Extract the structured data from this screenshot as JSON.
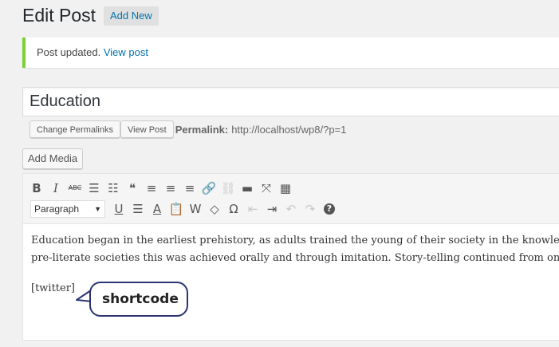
{
  "header": {
    "title": "Edit Post",
    "add_new": "Add New"
  },
  "notice": {
    "text": "Post updated.",
    "link": "View post",
    "color": "#7ad03a"
  },
  "post": {
    "title": "Education"
  },
  "permalink": {
    "change_button": "Change Permalinks",
    "view_button": "View Post",
    "label": "Permalink:",
    "url": "http://localhost/wp8/?p=1"
  },
  "media": {
    "add_media": "Add Media"
  },
  "toolbar": {
    "row1": [
      {
        "name": "bold-icon",
        "glyph": "B"
      },
      {
        "name": "italic-icon",
        "glyph": "I"
      },
      {
        "name": "strikethrough-icon",
        "glyph": "ABC"
      },
      {
        "name": "bullet-list-icon",
        "glyph": "☰"
      },
      {
        "name": "numbered-list-icon",
        "glyph": "☷"
      },
      {
        "name": "blockquote-icon",
        "glyph": "❝"
      },
      {
        "name": "align-left-icon",
        "glyph": "≡"
      },
      {
        "name": "align-center-icon",
        "glyph": "≡"
      },
      {
        "name": "align-right-icon",
        "glyph": "≡"
      },
      {
        "name": "insert-link-icon",
        "glyph": "🔗"
      },
      {
        "name": "unlink-icon",
        "glyph": "⛓"
      },
      {
        "name": "read-more-icon",
        "glyph": "▬"
      },
      {
        "name": "fullscreen-icon",
        "glyph": "⤧"
      },
      {
        "name": "toolbar-toggle-icon",
        "glyph": "▦"
      }
    ],
    "format_select": "Paragraph",
    "row2": [
      {
        "name": "underline-icon",
        "glyph": "U"
      },
      {
        "name": "justify-icon",
        "glyph": "☰"
      },
      {
        "name": "text-color-icon",
        "glyph": "A"
      },
      {
        "name": "paste-as-text-icon",
        "glyph": "📋"
      },
      {
        "name": "paste-from-word-icon",
        "glyph": "W"
      },
      {
        "name": "clear-formatting-icon",
        "glyph": "◇"
      },
      {
        "name": "special-character-icon",
        "glyph": "Ω"
      },
      {
        "name": "outdent-icon",
        "glyph": "⇤"
      },
      {
        "name": "indent-icon",
        "glyph": "⇥"
      },
      {
        "name": "undo-icon",
        "glyph": "↶"
      },
      {
        "name": "redo-icon",
        "glyph": "↷"
      },
      {
        "name": "help-icon",
        "glyph": "?"
      }
    ]
  },
  "content": {
    "line1": "Education began in the earliest prehistory, as adults trained the young of their society in the knowledge and s",
    "line2": "pre-literate societies this was achieved orally and through imitation. Story-telling continued from one genera",
    "shortcode": "[twitter]"
  },
  "callout": {
    "text": "shortcode",
    "border_color": "#2c3571"
  }
}
